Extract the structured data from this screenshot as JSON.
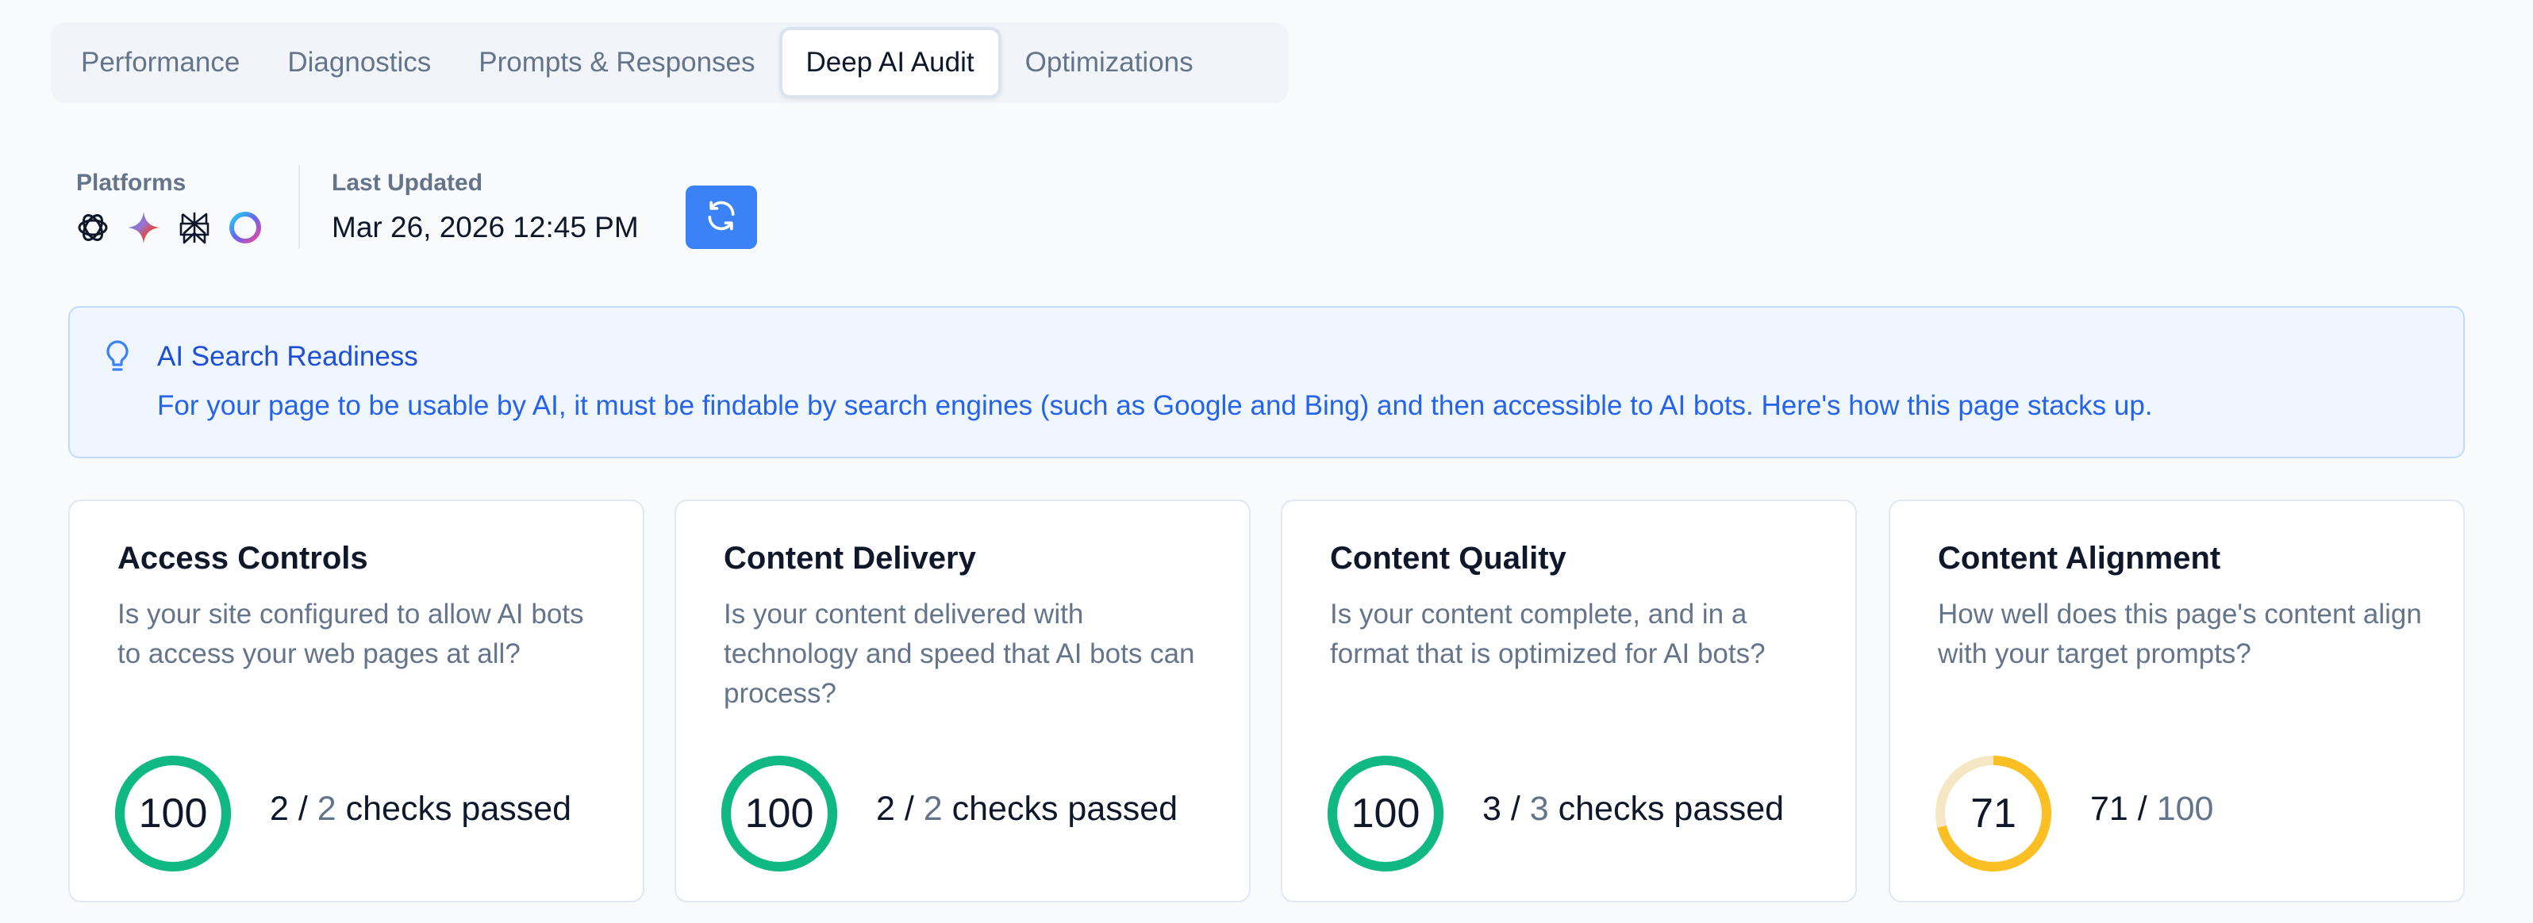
{
  "tabs": [
    {
      "label": "Performance",
      "active": false
    },
    {
      "label": "Diagnostics",
      "active": false
    },
    {
      "label": "Prompts & Responses",
      "active": false
    },
    {
      "label": "Deep AI Audit",
      "active": true
    },
    {
      "label": "Optimizations",
      "active": false
    }
  ],
  "meta": {
    "platforms_label": "Platforms",
    "platform_icons": [
      "chatgpt-icon",
      "gemini-icon",
      "perplexity-icon",
      "copilot-icon"
    ],
    "last_updated_label": "Last Updated",
    "last_updated_value": "Mar 26, 2026 12:45 PM",
    "refresh_icon": "refresh-icon"
  },
  "banner": {
    "icon": "lightbulb-icon",
    "title": "AI Search Readiness",
    "text": "For your page to be usable by AI, it must be findable by search engines (such as Google and Bing) and then accessible to AI bots. Here's how this page stacks up."
  },
  "cards": [
    {
      "title": "Access Controls",
      "description": "Is your site configured to allow AI bots to access your web pages at all?",
      "score": "100",
      "score_fraction": 1.0,
      "color": "#10b981",
      "passed": "2",
      "total": "2",
      "suffix": "checks passed"
    },
    {
      "title": "Content Delivery",
      "description": "Is your content delivered with technology and speed that AI bots can process?",
      "score": "100",
      "score_fraction": 1.0,
      "color": "#10b981",
      "passed": "2",
      "total": "2",
      "suffix": "checks passed"
    },
    {
      "title": "Content Quality",
      "description": "Is your content complete, and in a format that is optimized for AI bots?",
      "score": "100",
      "score_fraction": 1.0,
      "color": "#10b981",
      "passed": "3",
      "total": "3",
      "suffix": "checks passed"
    },
    {
      "title": "Content Alignment",
      "description": "How well does this page's content align with your target prompts?",
      "score": "71",
      "score_fraction": 0.71,
      "color": "#fbbf24",
      "passed": "71",
      "total": "100",
      "suffix": ""
    }
  ],
  "colors": {
    "accent": "#3b82f6",
    "success": "#10b981",
    "warning": "#fbbf24",
    "warning_track": "#f5e6c4",
    "banner_bg": "#eff6ff",
    "banner_text": "#2563eb"
  }
}
